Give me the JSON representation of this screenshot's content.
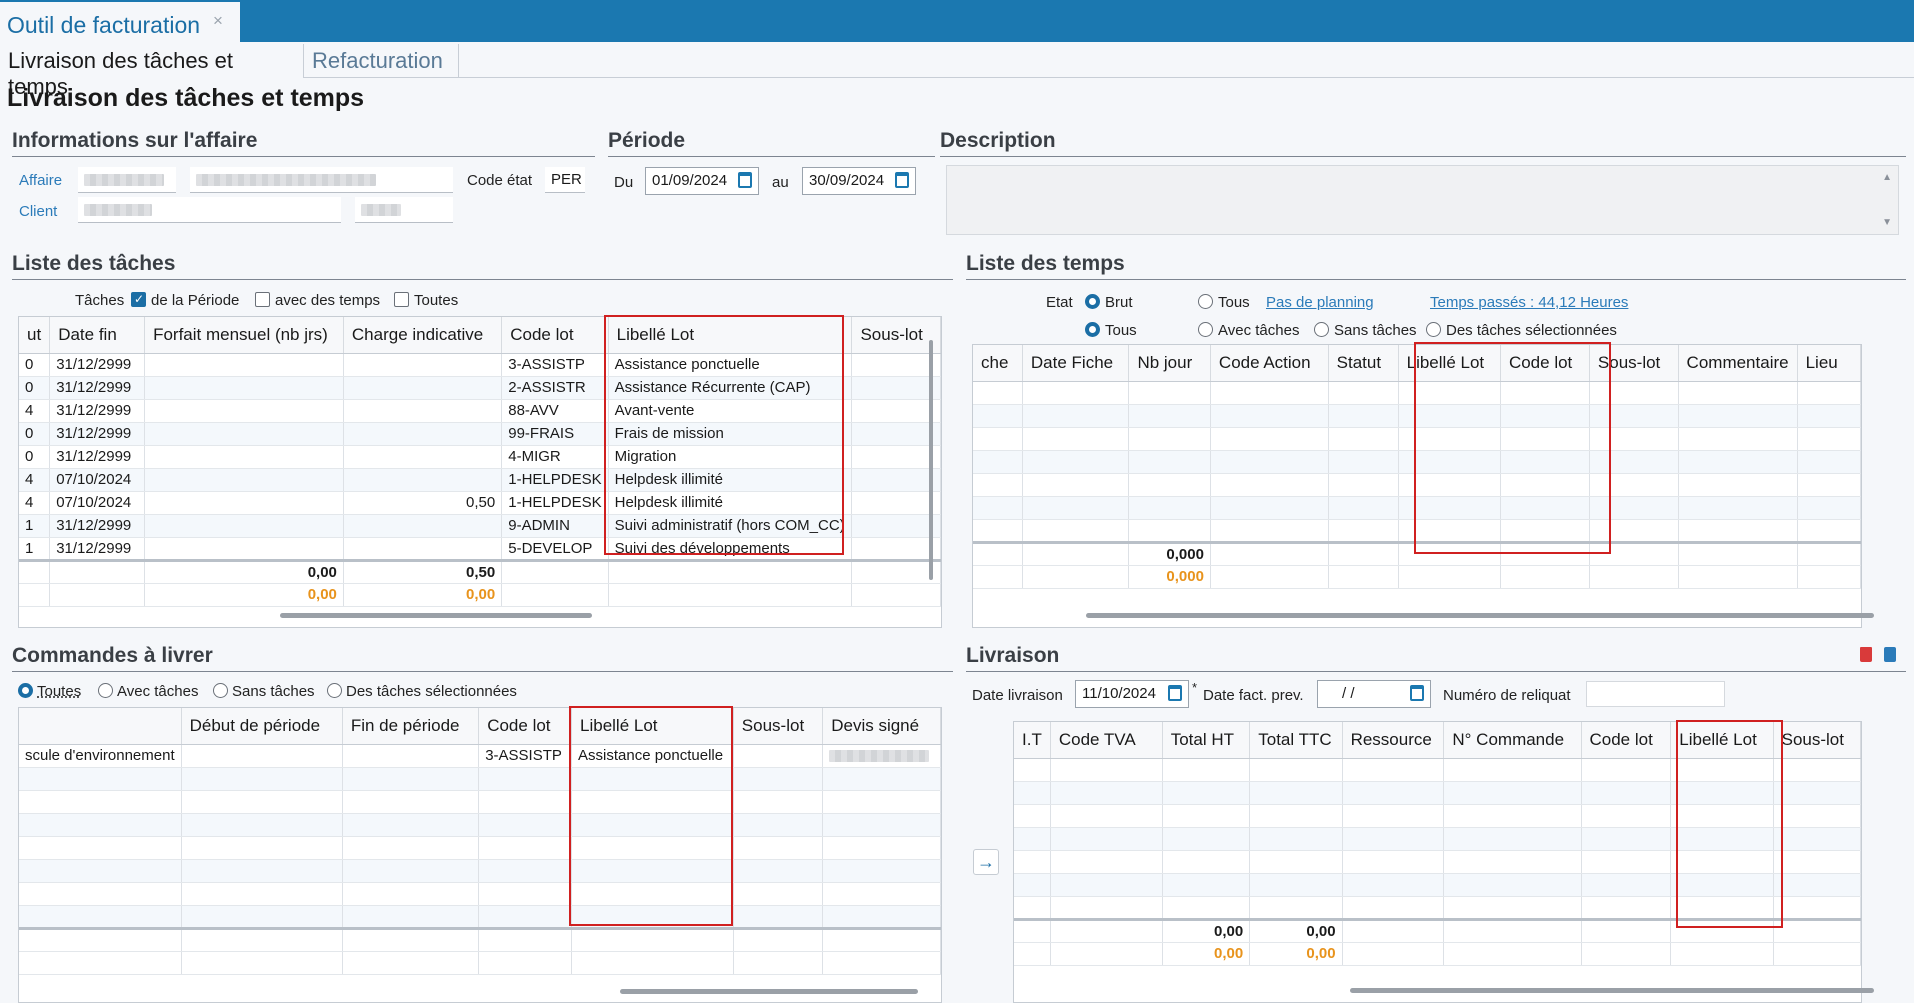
{
  "app": {
    "tab_title": "Outil de facturation",
    "close_glyph": "×"
  },
  "subtabs": [
    "Livraison des tâches et temps",
    "Refacturation"
  ],
  "page_title": "Livraison des tâches et temps",
  "affaire": {
    "section": "Informations sur l'affaire",
    "affaire_label": "Affaire",
    "client_label": "Client",
    "code_etat_label": "Code état",
    "code_etat_value": "PER"
  },
  "periode": {
    "section": "Période",
    "du_label": "Du",
    "du_value": "01/09/2024",
    "au_label": "au",
    "au_value": "30/09/2024"
  },
  "description": {
    "section": "Description"
  },
  "taches": {
    "section": "Liste des tâches",
    "filter_label": "Tâches",
    "filters": [
      {
        "label": "de la Période",
        "checked": true
      },
      {
        "label": "avec des temps",
        "checked": false
      },
      {
        "label": "Toutes",
        "checked": false
      }
    ],
    "columns": [
      "ut",
      "Date fin",
      "Forfait mensuel (nb jrs)",
      "Charge indicative",
      "Code lot",
      "Libellé Lot",
      "Sous-lot"
    ],
    "rows": [
      [
        "0",
        "31/12/2999",
        "",
        "",
        "3-ASSISTP",
        "Assistance ponctuelle",
        ""
      ],
      [
        "0",
        "31/12/2999",
        "",
        "",
        "2-ASSISTR",
        "Assistance Récurrente (CAP)",
        ""
      ],
      [
        "4",
        "31/12/2999",
        "",
        "",
        "88-AVV",
        "Avant-vente",
        ""
      ],
      [
        "0",
        "31/12/2999",
        "",
        "",
        "99-FRAIS",
        "Frais de mission",
        ""
      ],
      [
        "0",
        "31/12/2999",
        "",
        "",
        "4-MIGR",
        "Migration",
        ""
      ],
      [
        "4",
        "07/10/2024",
        "",
        "",
        "1-HELPDESK",
        "Helpdesk illimité",
        ""
      ],
      [
        "4",
        "07/10/2024",
        "",
        "0,50",
        "1-HELPDESK",
        "Helpdesk illimité",
        ""
      ],
      [
        "1",
        "31/12/2999",
        "",
        "",
        "9-ADMIN",
        "Suivi administratif (hors COM_CC)",
        ""
      ],
      [
        "1",
        "31/12/2999",
        "",
        "",
        "5-DEVELOP",
        "Suivi des développements",
        ""
      ]
    ],
    "totals1": [
      "0,00",
      "0,50"
    ],
    "totals2": [
      "0,00",
      "0,00"
    ]
  },
  "temps": {
    "section": "Liste des temps",
    "etat_label": "Etat",
    "radios_col1": [
      {
        "label": "Brut",
        "on": true
      },
      {
        "label": "Tous",
        "on": true
      }
    ],
    "radios_col2": [
      {
        "label": "Tous",
        "on": false
      },
      {
        "label": "Avec tâches",
        "on": false
      }
    ],
    "radios_col3": [
      {
        "label": "Sans tâches",
        "on": false
      }
    ],
    "radios_col4": [
      {
        "label": "Des tâches sélectionnées",
        "on": false
      }
    ],
    "link_planning": "Pas de planning",
    "link_temps": "Temps passés : 44,12 Heures",
    "columns": [
      "che",
      "Date Fiche",
      "Nb jour",
      "Code Action",
      "Statut",
      "Libellé Lot",
      "Code lot",
      "Sous-lot",
      "Commentaire",
      "Lieu"
    ],
    "total1": "0,000",
    "total2": "0,000"
  },
  "commandes": {
    "section": "Commandes à livrer",
    "radios": [
      {
        "label": "Toutes",
        "on": true
      },
      {
        "label": "Avec tâches",
        "on": false
      },
      {
        "label": "Sans tâches",
        "on": false
      },
      {
        "label": "Des tâches sélectionnées",
        "on": false
      }
    ],
    "columns": [
      "",
      "Début de période",
      "Fin de période",
      "Code lot",
      "Libellé Lot",
      "Sous-lot",
      "Devis signé"
    ],
    "rows": [
      [
        "scule d'environnement",
        "",
        "",
        "3-ASSISTP",
        "Assistance ponctuelle",
        "",
        ""
      ]
    ]
  },
  "livraison": {
    "section": "Livraison",
    "date_livraison_label": "Date livraison",
    "date_livraison_value": "11/10/2024",
    "required_mark": "*",
    "date_fact_label": "Date fact. prev.",
    "date_fact_value": "/ /",
    "reliquat_label": "Numéro de reliquat",
    "columns": [
      "I.T",
      "Code TVA",
      "Total HT",
      "Total TTC",
      "Ressource",
      "N° Commande",
      "Code lot",
      "Libellé Lot",
      "Sous-lot"
    ],
    "totals1": [
      "0,00",
      "0,00"
    ],
    "totals2": [
      "0,00",
      "0,00"
    ],
    "arrow_glyph": "→"
  }
}
